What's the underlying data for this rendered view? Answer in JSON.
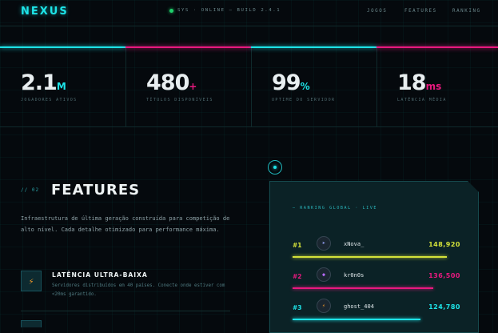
{
  "nav": {
    "logo": "NEXUS",
    "status": "SYS · ONLINE — BUILD 2.4.1",
    "menu": [
      "JOGOS",
      "FEATURES",
      "RANKING"
    ]
  },
  "stats": [
    {
      "value": "2.1",
      "unit": "M",
      "label": "JOGADORES ATIVOS",
      "accent": "#1de4e8"
    },
    {
      "value": "480",
      "unit": "+",
      "label": "TÍTULOS DISPONÍVEIS",
      "accent": "#e8197f"
    },
    {
      "value": "99",
      "unit": "%",
      "label": "UPTIME DO SERVIDOR",
      "accent": "#1de4e8"
    },
    {
      "value": "18",
      "unit": "ms",
      "label": "LATÊNCIA MÉDIA",
      "accent": "#e8197f"
    }
  ],
  "features": {
    "tag": "// 02",
    "title": "FEATURES",
    "description": "Infraestrutura de última geração construída para competição de alto nível. Cada detalhe otimizado para performance máxima.",
    "items": [
      {
        "icon": "lightning-icon",
        "title": "LATÊNCIA ULTRA-BAIXA",
        "description": "Servidores distribuídos em 40 países. Conecte onde estiver com <20ms garantido."
      }
    ]
  },
  "ranking": {
    "title": "— RANKING GLOBAL · LIVE",
    "rows": [
      {
        "rank": "#1",
        "name": "xNova_",
        "score": "148,920",
        "color": "#d4e23a",
        "avatar_icon": "arrow-icon",
        "bar": 0.92
      },
      {
        "rank": "#2",
        "name": "kr0n0s",
        "score": "136,500",
        "color": "#e8197f",
        "avatar_icon": "mask-icon",
        "bar": 0.84
      },
      {
        "rank": "#3",
        "name": "ghost_404",
        "score": "124,780",
        "color": "#1de4e8",
        "avatar_icon": "lightning-icon",
        "bar": 0.76
      }
    ]
  },
  "colors": {
    "cyan": "#1de4e8",
    "magenta": "#e8197f",
    "lime": "#d4e23a",
    "background": "#05090d"
  }
}
